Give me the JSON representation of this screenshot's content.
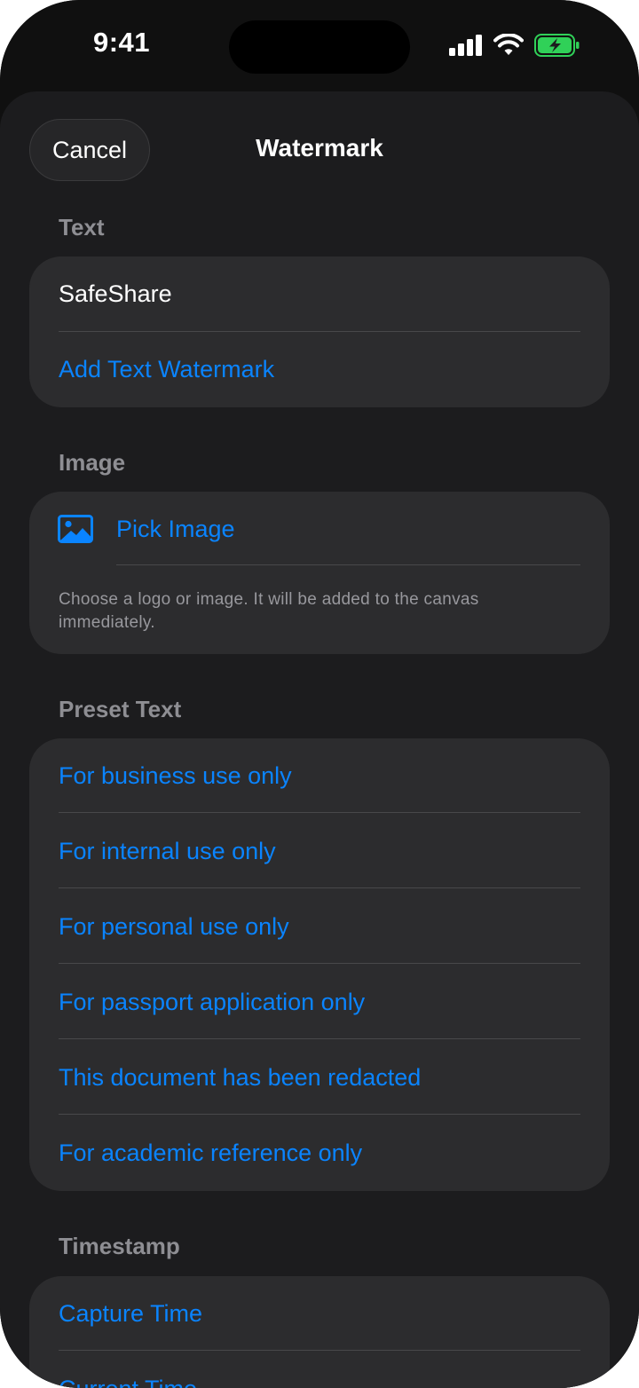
{
  "status_bar": {
    "time": "9:41",
    "signal_icon": "cellular-signal-icon",
    "wifi_icon": "wifi-icon",
    "battery_icon": "battery-charging-icon",
    "battery_color": "#30d158"
  },
  "header": {
    "cancel_label": "Cancel",
    "title": "Watermark"
  },
  "text_section": {
    "header": "Text",
    "value": "SafeShare",
    "add_label": "Add Text Watermark"
  },
  "image_section": {
    "header": "Image",
    "icon": "photo-icon",
    "pick_label": "Pick Image",
    "footnote": "Choose a logo or image. It will be added to the canvas immediately."
  },
  "preset_section": {
    "header": "Preset Text",
    "items": [
      "For business use only",
      "For internal use only",
      "For personal use only",
      "For passport application only",
      "This document has been redacted",
      "For academic reference only"
    ]
  },
  "timestamp_section": {
    "header": "Timestamp",
    "items": [
      "Capture Time",
      "Current Time"
    ]
  },
  "colors": {
    "accent": "#0a84ff",
    "sheet_background": "#1c1c1e",
    "card_background": "#2c2c2e"
  }
}
